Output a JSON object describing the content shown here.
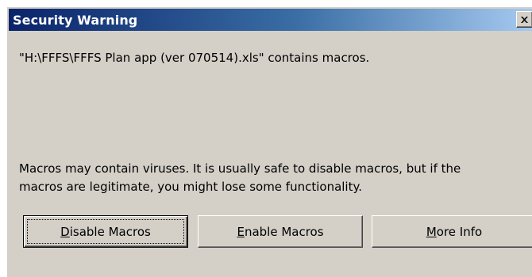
{
  "window": {
    "title": "Security Warning"
  },
  "title_bar": {
    "close_icon": "close-icon"
  },
  "message": {
    "line1": "\"H:\\FFFS\\FFFS Plan app (ver 070514).xls\" contains macros.",
    "line2": "Macros may contain viruses. It is usually safe to disable macros, but if the\nmacros are legitimate, you might lose some functionality."
  },
  "buttons": {
    "disable": {
      "mnemonic": "D",
      "rest": "isable Macros"
    },
    "enable": {
      "mnemonic": "E",
      "rest": "nable Macros"
    },
    "info": {
      "mnemonic": "M",
      "rest": "ore Info"
    }
  },
  "colors": {
    "dialog_bg": "#d4d0c8",
    "titlebar_start": "#0a246a",
    "titlebar_end": "#a6caf0"
  }
}
